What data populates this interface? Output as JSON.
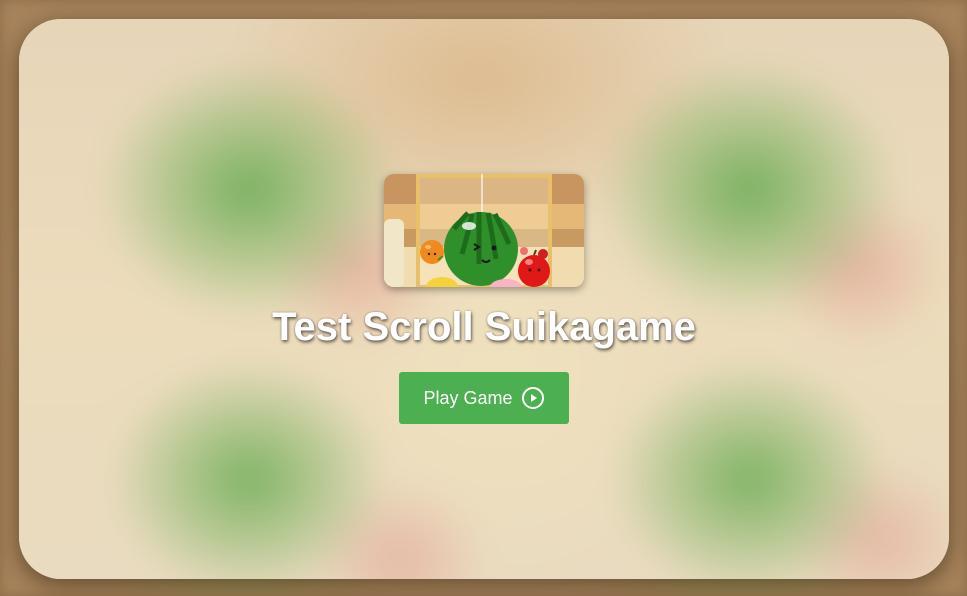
{
  "game": {
    "title": "Test Scroll Suikagame",
    "thumbnail_icon": "watermelon-game-thumbnail"
  },
  "play_button": {
    "label": "Play Game",
    "icon": "play-circle-icon",
    "color": "#4caf50"
  }
}
